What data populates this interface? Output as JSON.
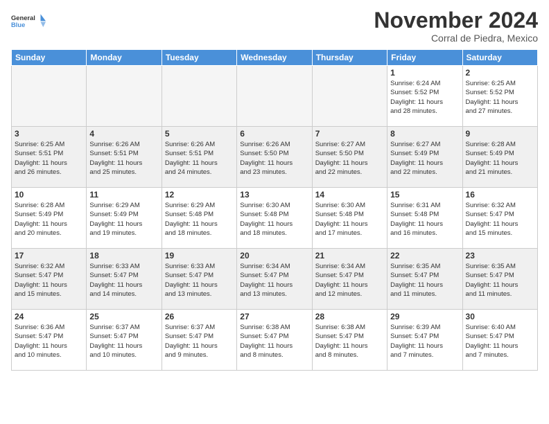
{
  "header": {
    "logo_line1": "General",
    "logo_line2": "Blue",
    "month": "November 2024",
    "location": "Corral de Piedra, Mexico"
  },
  "weekdays": [
    "Sunday",
    "Monday",
    "Tuesday",
    "Wednesday",
    "Thursday",
    "Friday",
    "Saturday"
  ],
  "weeks": [
    [
      {
        "day": "",
        "info": "",
        "empty": true
      },
      {
        "day": "",
        "info": "",
        "empty": true
      },
      {
        "day": "",
        "info": "",
        "empty": true
      },
      {
        "day": "",
        "info": "",
        "empty": true
      },
      {
        "day": "",
        "info": "",
        "empty": true
      },
      {
        "day": "1",
        "info": "Sunrise: 6:24 AM\nSunset: 5:52 PM\nDaylight: 11 hours\nand 28 minutes."
      },
      {
        "day": "2",
        "info": "Sunrise: 6:25 AM\nSunset: 5:52 PM\nDaylight: 11 hours\nand 27 minutes."
      }
    ],
    [
      {
        "day": "3",
        "info": "Sunrise: 6:25 AM\nSunset: 5:51 PM\nDaylight: 11 hours\nand 26 minutes."
      },
      {
        "day": "4",
        "info": "Sunrise: 6:26 AM\nSunset: 5:51 PM\nDaylight: 11 hours\nand 25 minutes."
      },
      {
        "day": "5",
        "info": "Sunrise: 6:26 AM\nSunset: 5:51 PM\nDaylight: 11 hours\nand 24 minutes."
      },
      {
        "day": "6",
        "info": "Sunrise: 6:26 AM\nSunset: 5:50 PM\nDaylight: 11 hours\nand 23 minutes."
      },
      {
        "day": "7",
        "info": "Sunrise: 6:27 AM\nSunset: 5:50 PM\nDaylight: 11 hours\nand 22 minutes."
      },
      {
        "day": "8",
        "info": "Sunrise: 6:27 AM\nSunset: 5:49 PM\nDaylight: 11 hours\nand 22 minutes."
      },
      {
        "day": "9",
        "info": "Sunrise: 6:28 AM\nSunset: 5:49 PM\nDaylight: 11 hours\nand 21 minutes."
      }
    ],
    [
      {
        "day": "10",
        "info": "Sunrise: 6:28 AM\nSunset: 5:49 PM\nDaylight: 11 hours\nand 20 minutes."
      },
      {
        "day": "11",
        "info": "Sunrise: 6:29 AM\nSunset: 5:49 PM\nDaylight: 11 hours\nand 19 minutes."
      },
      {
        "day": "12",
        "info": "Sunrise: 6:29 AM\nSunset: 5:48 PM\nDaylight: 11 hours\nand 18 minutes."
      },
      {
        "day": "13",
        "info": "Sunrise: 6:30 AM\nSunset: 5:48 PM\nDaylight: 11 hours\nand 18 minutes."
      },
      {
        "day": "14",
        "info": "Sunrise: 6:30 AM\nSunset: 5:48 PM\nDaylight: 11 hours\nand 17 minutes."
      },
      {
        "day": "15",
        "info": "Sunrise: 6:31 AM\nSunset: 5:48 PM\nDaylight: 11 hours\nand 16 minutes."
      },
      {
        "day": "16",
        "info": "Sunrise: 6:32 AM\nSunset: 5:47 PM\nDaylight: 11 hours\nand 15 minutes."
      }
    ],
    [
      {
        "day": "17",
        "info": "Sunrise: 6:32 AM\nSunset: 5:47 PM\nDaylight: 11 hours\nand 15 minutes."
      },
      {
        "day": "18",
        "info": "Sunrise: 6:33 AM\nSunset: 5:47 PM\nDaylight: 11 hours\nand 14 minutes."
      },
      {
        "day": "19",
        "info": "Sunrise: 6:33 AM\nSunset: 5:47 PM\nDaylight: 11 hours\nand 13 minutes."
      },
      {
        "day": "20",
        "info": "Sunrise: 6:34 AM\nSunset: 5:47 PM\nDaylight: 11 hours\nand 13 minutes."
      },
      {
        "day": "21",
        "info": "Sunrise: 6:34 AM\nSunset: 5:47 PM\nDaylight: 11 hours\nand 12 minutes."
      },
      {
        "day": "22",
        "info": "Sunrise: 6:35 AM\nSunset: 5:47 PM\nDaylight: 11 hours\nand 11 minutes."
      },
      {
        "day": "23",
        "info": "Sunrise: 6:35 AM\nSunset: 5:47 PM\nDaylight: 11 hours\nand 11 minutes."
      }
    ],
    [
      {
        "day": "24",
        "info": "Sunrise: 6:36 AM\nSunset: 5:47 PM\nDaylight: 11 hours\nand 10 minutes."
      },
      {
        "day": "25",
        "info": "Sunrise: 6:37 AM\nSunset: 5:47 PM\nDaylight: 11 hours\nand 10 minutes."
      },
      {
        "day": "26",
        "info": "Sunrise: 6:37 AM\nSunset: 5:47 PM\nDaylight: 11 hours\nand 9 minutes."
      },
      {
        "day": "27",
        "info": "Sunrise: 6:38 AM\nSunset: 5:47 PM\nDaylight: 11 hours\nand 8 minutes."
      },
      {
        "day": "28",
        "info": "Sunrise: 6:38 AM\nSunset: 5:47 PM\nDaylight: 11 hours\nand 8 minutes."
      },
      {
        "day": "29",
        "info": "Sunrise: 6:39 AM\nSunset: 5:47 PM\nDaylight: 11 hours\nand 7 minutes."
      },
      {
        "day": "30",
        "info": "Sunrise: 6:40 AM\nSunset: 5:47 PM\nDaylight: 11 hours\nand 7 minutes."
      }
    ]
  ]
}
